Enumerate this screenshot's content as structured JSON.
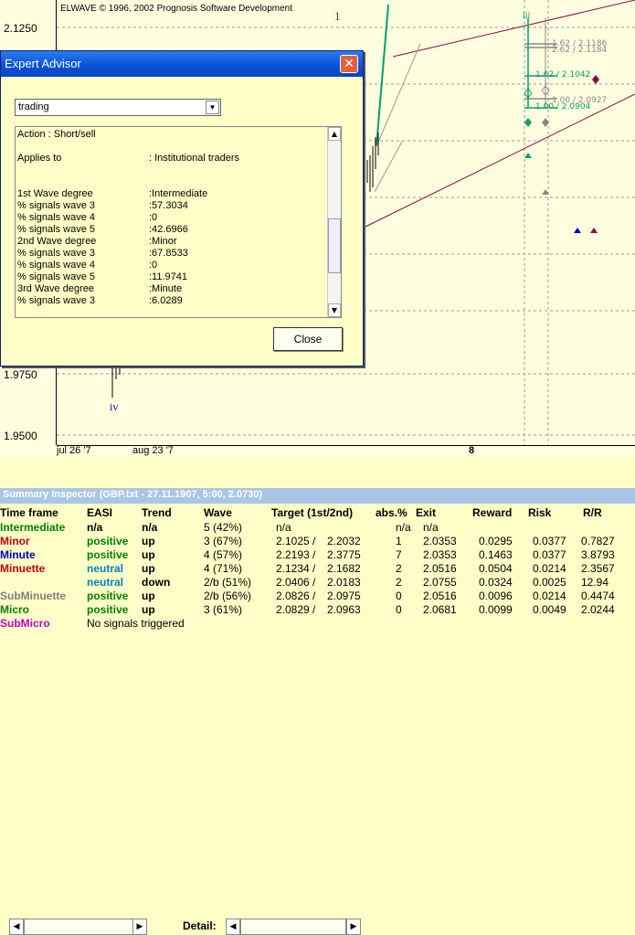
{
  "chart": {
    "copyright": "ELWAVE © 1996, 2002 Prognosis Software Development",
    "y_ticks": [
      "2.1250",
      "1.9750",
      "1.9500"
    ],
    "x_ticks": [
      "jul 26 '7",
      "aug 23 '7",
      "8"
    ],
    "wave_labels": {
      "one": "1",
      "three": "iii",
      "iv": "iv"
    },
    "fib_labels": [
      "1.62 / 2.1186",
      "2.62 / 2.1184",
      "1.62 / 2.1042",
      "1.00 / 2.0927",
      "1.00 / 2.0904"
    ]
  },
  "toolbar": {
    "detail_label": "Detail:"
  },
  "summary": {
    "title": "Summary Inspector (GBP.txt - 27.11.1907, 5:00, 2.0730)",
    "headers": [
      "Time frame",
      "EASI",
      "Trend",
      "Wave",
      "Target (1st/2nd)",
      "abs.%",
      "Exit",
      "Reward",
      "Risk",
      "R/R"
    ],
    "rows": [
      {
        "tf": "Intermediate",
        "tf_color": "#008000",
        "easi": "n/a",
        "easi_color": "#000000",
        "trend": "n/a",
        "wave": "5 (42%)",
        "t1": "n/a",
        "t2": "",
        "abs": "n/a",
        "exit": "n/a",
        "reward": "",
        "risk": "",
        "rr": ""
      },
      {
        "tf": "Minor",
        "tf_color": "#c00000",
        "easi": "positive",
        "easi_color": "#008000",
        "trend": "up",
        "wave": "3 (67%)",
        "t1": "2.1025 /",
        "t2": "2.2032",
        "abs": "1",
        "exit": "2.0353",
        "reward": "0.0295",
        "risk": "0.0377",
        "rr": "0.7827"
      },
      {
        "tf": "Minute",
        "tf_color": "#0000c0",
        "easi": "positive",
        "easi_color": "#008000",
        "trend": "up",
        "wave": "4 (57%)",
        "t1": "2.2193 /",
        "t2": "2.3775",
        "abs": "7",
        "exit": "2.0353",
        "reward": "0.1463",
        "risk": "0.0377",
        "rr": "3.8793"
      },
      {
        "tf": "Minuette",
        "tf_color": "#c00000",
        "easi": "neutral",
        "easi_color": "#0080c0",
        "trend": "up",
        "wave": "4 (71%)",
        "t1": "2.1234 /",
        "t2": "2.1682",
        "abs": "2",
        "exit": "2.0516",
        "reward": "0.0504",
        "risk": "0.0214",
        "rr": "2.3567"
      },
      {
        "tf": "",
        "tf_color": "#000000",
        "easi": "neutral",
        "easi_color": "#0080c0",
        "trend": "down",
        "wave": "2/b (51%)",
        "t1": "2.0406 /",
        "t2": "2.0183",
        "abs": "2",
        "exit": "2.0755",
        "reward": "0.0324",
        "risk": "0.0025",
        "rr": "12.94"
      },
      {
        "tf": "SubMinuette",
        "tf_color": "#808080",
        "easi": "positive",
        "easi_color": "#008000",
        "trend": "up",
        "wave": "2/b (56%)",
        "t1": "2.0826 /",
        "t2": "2.0975",
        "abs": "0",
        "exit": "2.0516",
        "reward": "0.0096",
        "risk": "0.0214",
        "rr": "0.4474"
      },
      {
        "tf": "Micro",
        "tf_color": "#008000",
        "easi": "positive",
        "easi_color": "#008000",
        "trend": "up",
        "wave": "3 (61%)",
        "t1": "2.0829 /",
        "t2": "2.0963",
        "abs": "0",
        "exit": "2.0681",
        "reward": "0.0099",
        "risk": "0.0049",
        "rr": "2.0244"
      },
      {
        "tf": "SubMicro",
        "tf_color": "#c000c0",
        "easi": "No signals triggered",
        "easi_color": "#000000",
        "trend": "",
        "wave": "",
        "t1": "",
        "t2": "",
        "abs": "",
        "exit": "",
        "reward": "",
        "risk": "",
        "rr": ""
      }
    ]
  },
  "dialog": {
    "title": "Expert Advisor",
    "select_value": "trading",
    "lines": [
      {
        "k": "Action        : Short/sell",
        "v": ""
      },
      {
        "k": "",
        "v": ""
      },
      {
        "k": "Applies to",
        "v": ": Institutional traders"
      },
      {
        "k": "",
        "v": ""
      },
      {
        "k": "",
        "v": ""
      },
      {
        "k": "1st Wave degree",
        "v": ":Intermediate"
      },
      {
        "k": "% signals  wave 3",
        "v": ":57.3034"
      },
      {
        "k": "% signals  wave 4",
        "v": ":0"
      },
      {
        "k": "% signals  wave 5",
        "v": ":42.6966"
      },
      {
        "k": "2nd Wave degree",
        "v": ":Minor"
      },
      {
        "k": "% signals  wave 3",
        "v": ":67.8533"
      },
      {
        "k": "% signals  wave 4",
        "v": ":0"
      },
      {
        "k": "% signals  wave 5",
        "v": ":11.9741"
      },
      {
        "k": "3rd Wave degree",
        "v": ":Minute"
      },
      {
        "k": "% signals  wave 3",
        "v": ":6.0289"
      }
    ],
    "close_label": "Close"
  }
}
